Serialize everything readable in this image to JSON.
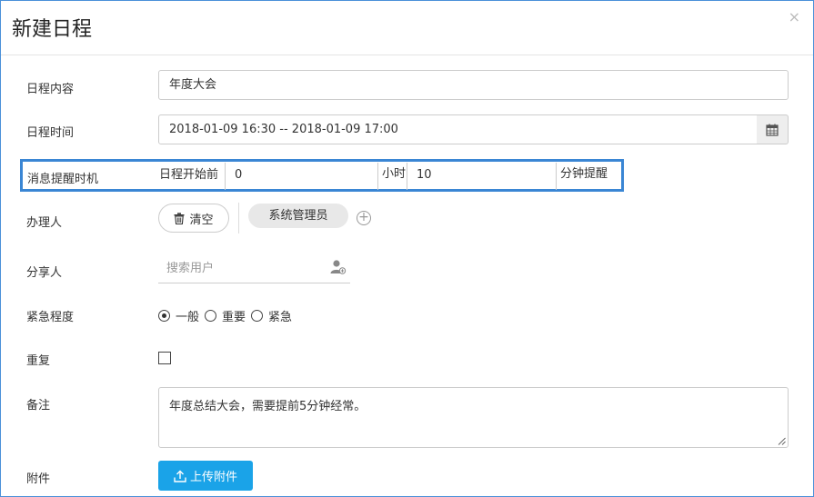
{
  "dialog": {
    "title": "新建日程",
    "close_label": "×"
  },
  "form": {
    "content": {
      "label": "日程内容",
      "value": "年度大会"
    },
    "time": {
      "label": "日程时间",
      "value": "2018-01-09 16:30 -- 2018-01-09 17:00",
      "icon": "calendar-icon"
    },
    "reminder": {
      "label": "消息提醒时机",
      "prefix": "日程开始前",
      "hours_value": "0",
      "hours_unit": "小时",
      "minutes_value": "10",
      "minutes_unit": "分钟提醒"
    },
    "assignee": {
      "label": "办理人",
      "clear_label": "清空",
      "chips": [
        "系统管理员"
      ],
      "add_icon": "plus-circle-icon"
    },
    "share": {
      "label": "分享人",
      "search_placeholder": "搜索用户",
      "icon": "add-user-icon"
    },
    "urgency": {
      "label": "紧急程度",
      "options": [
        "一般",
        "重要",
        "紧急"
      ],
      "selected": "一般"
    },
    "repeat": {
      "label": "重复",
      "checked": false
    },
    "note": {
      "label": "备注",
      "value": "年度总结大会，需要提前5分钟经常。"
    },
    "attachment": {
      "label": "附件",
      "upload_label": "上传附件"
    }
  },
  "colors": {
    "highlight_border": "#3a86d4",
    "upload_button": "#1aa3e8"
  }
}
